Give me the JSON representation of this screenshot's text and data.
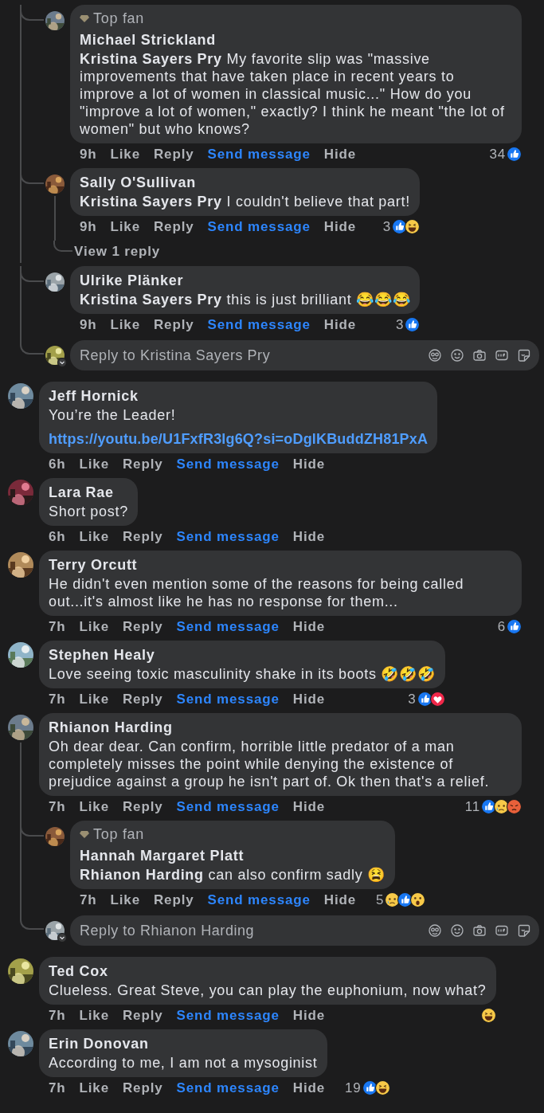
{
  "continued_thread": {
    "replies": [
      {
        "badge": "Top fan",
        "author": "Michael Strickland",
        "text": "**Kristina Sayers Pry** My favorite slip was \"massive improvements that have taken place in recent years to improve a lot of women in classical music...\" How do you \"improve a lot of women,\" exactly? I think he meant \"the lot of women\" but who knows?",
        "time": "9h",
        "actions": [
          {
            "label": "Like",
            "kind": "like"
          },
          {
            "label": "Reply",
            "kind": "reply"
          },
          {
            "label": "Send message",
            "kind": "message"
          },
          {
            "label": "Hide",
            "kind": "hide"
          }
        ],
        "reaction_count": "34",
        "reactions": [
          {
            "kind": "like"
          }
        ]
      },
      {
        "author": "Sally O'Sullivan",
        "text": "**Kristina Sayers Pry** I couldn't believe that part!",
        "time": "9h",
        "actions": [
          {
            "label": "Like",
            "kind": "like"
          },
          {
            "label": "Reply",
            "kind": "reply"
          },
          {
            "label": "Send message",
            "kind": "message"
          },
          {
            "label": "Hide",
            "kind": "hide"
          }
        ],
        "reaction_count": "3",
        "reactions": [
          {
            "kind": "like"
          },
          {
            "kind": "haha"
          }
        ],
        "more_replies": "View 1 reply"
      },
      {
        "author": "Ulrike Plänker",
        "text": "**Kristina Sayers Pry** this is just brilliant 😂😂😂",
        "time": "9h",
        "actions": [
          {
            "label": "Like",
            "kind": "like"
          },
          {
            "label": "Reply",
            "kind": "reply"
          },
          {
            "label": "Send message",
            "kind": "message"
          },
          {
            "label": "Hide",
            "kind": "hide"
          }
        ],
        "reaction_count": "3",
        "reactions": [
          {
            "kind": "like"
          }
        ]
      }
    ],
    "reply_box": {
      "placeholder": "Reply to Kristina Sayers Pry"
    }
  },
  "comments": [
    {
      "author": "Jeff Hornick",
      "text": "You’re the Leader!",
      "link": "https://youtu.be/U1FxfR3lg6Q?si=oDglKBuddZH81PxA",
      "time": "6h",
      "actions": [
        {
          "label": "Like",
          "kind": "like"
        },
        {
          "label": "Reply",
          "kind": "reply"
        },
        {
          "label": "Send message",
          "kind": "message"
        },
        {
          "label": "Hide",
          "kind": "hide"
        }
      ]
    },
    {
      "author": "Lara Rae",
      "text": "Short post?",
      "time": "6h",
      "actions": [
        {
          "label": "Like",
          "kind": "like"
        },
        {
          "label": "Reply",
          "kind": "reply"
        },
        {
          "label": "Send message",
          "kind": "message"
        },
        {
          "label": "Hide",
          "kind": "hide"
        }
      ]
    },
    {
      "author": "Terry Orcutt",
      "text": "He didn't even mention some of the reasons for being called out...it's almost like he has no response for them...",
      "time": "7h",
      "actions": [
        {
          "label": "Like",
          "kind": "like"
        },
        {
          "label": "Reply",
          "kind": "reply"
        },
        {
          "label": "Send message",
          "kind": "message"
        },
        {
          "label": "Hide",
          "kind": "hide"
        }
      ],
      "reaction_count": "6",
      "reactions": [
        {
          "kind": "like"
        }
      ]
    },
    {
      "author": "Stephen Healy",
      "text": "Love seeing toxic masculinity shake in its boots 🤣🤣🤣",
      "time": "7h",
      "actions": [
        {
          "label": "Like",
          "kind": "like"
        },
        {
          "label": "Reply",
          "kind": "reply"
        },
        {
          "label": "Send message",
          "kind": "message"
        },
        {
          "label": "Hide",
          "kind": "hide"
        }
      ],
      "reaction_count": "3",
      "reactions": [
        {
          "kind": "like"
        },
        {
          "kind": "love"
        }
      ]
    },
    {
      "author": "Rhianon Harding",
      "text": "Oh dear dear. Can confirm, horrible little predator of a man completely misses the point while denying the existence of prejudice against a group he isn't part of. Ok then that's a relief.",
      "time": "7h",
      "actions": [
        {
          "label": "Like",
          "kind": "like"
        },
        {
          "label": "Reply",
          "kind": "reply"
        },
        {
          "label": "Send message",
          "kind": "message"
        },
        {
          "label": "Hide",
          "kind": "hide"
        }
      ],
      "reaction_count": "11",
      "reactions": [
        {
          "kind": "like"
        },
        {
          "kind": "sad"
        },
        {
          "kind": "angry"
        }
      ],
      "replies": [
        {
          "badge": "Top fan",
          "author": "Hannah Margaret Platt",
          "text": "**Rhianon Harding** can also confirm sadly 😫",
          "time": "7h",
          "actions": [
            {
              "label": "Like",
              "kind": "like"
            },
            {
              "label": "Reply",
              "kind": "reply"
            },
            {
              "label": "Send message",
              "kind": "message"
            },
            {
              "label": "Hide",
              "kind": "hide"
            }
          ],
          "reaction_count": "5",
          "reactions": [
            {
              "kind": "sad"
            },
            {
              "kind": "like"
            },
            {
              "kind": "wow"
            }
          ]
        }
      ],
      "reply_box": {
        "placeholder": "Reply to Rhianon Harding"
      }
    },
    {
      "author": "Ted Cox",
      "text": "Clueless. Great Steve, you can play the euphonium, now what?",
      "time": "7h",
      "actions": [
        {
          "label": "Like",
          "kind": "like"
        },
        {
          "label": "Reply",
          "kind": "reply"
        },
        {
          "label": "Send message",
          "kind": "message"
        },
        {
          "label": "Hide",
          "kind": "hide"
        }
      ],
      "reactions": [
        {
          "kind": "haha"
        }
      ]
    },
    {
      "author": "Erin Donovan",
      "text": "According to me, I am not a mysoginist",
      "time": "7h",
      "actions": [
        {
          "label": "Like",
          "kind": "like"
        },
        {
          "label": "Reply",
          "kind": "reply"
        },
        {
          "label": "Send message",
          "kind": "message"
        },
        {
          "label": "Hide",
          "kind": "hide"
        }
      ],
      "reaction_count": "19",
      "reactions": [
        {
          "kind": "like"
        },
        {
          "kind": "haha"
        }
      ]
    }
  ]
}
